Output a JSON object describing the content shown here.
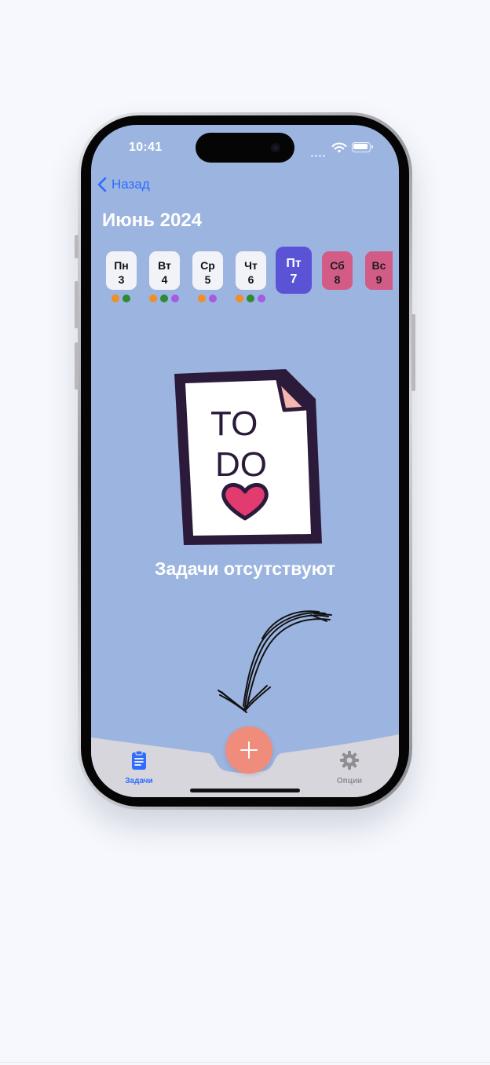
{
  "status_bar": {
    "time": "10:41"
  },
  "nav": {
    "back_label": "Назад"
  },
  "calendar": {
    "month_title": "Июнь 2024",
    "days": [
      {
        "name": "Пн",
        "date": "3",
        "kind": "normal",
        "dots": [
          "#ef8f26",
          "#2f8a32"
        ]
      },
      {
        "name": "Вт",
        "date": "4",
        "kind": "normal",
        "dots": [
          "#ef8f26",
          "#2f8a32",
          "#a55ce0"
        ]
      },
      {
        "name": "Ср",
        "date": "5",
        "kind": "normal",
        "dots": [
          "#ef8f26",
          "#a55ce0"
        ]
      },
      {
        "name": "Чт",
        "date": "6",
        "kind": "normal",
        "dots": [
          "#ef8f26",
          "#2f8a32",
          "#a55ce0"
        ]
      },
      {
        "name": "Пт",
        "date": "7",
        "kind": "selected",
        "dots": []
      },
      {
        "name": "Сб",
        "date": "8",
        "kind": "weekend",
        "dots": []
      },
      {
        "name": "Вс",
        "date": "9",
        "kind": "weekend",
        "dots": []
      }
    ]
  },
  "empty_state": {
    "message": "Задачи отсутствуют",
    "illustration_line1": "TO",
    "illustration_line2": "DO"
  },
  "tabbar": {
    "tasks_label": "Задачи",
    "tasks_icon": "clipboard-icon",
    "options_label": "Опции",
    "options_icon": "gear-icon",
    "add_icon": "plus-icon",
    "active_color": "#2f6bff",
    "inactive_color": "#8e8e93"
  },
  "colors": {
    "screen_background": "#9cb4e0",
    "selected_day": "#5a53d6",
    "weekend_day": "#d35c86",
    "fab": "#f08c7c"
  }
}
